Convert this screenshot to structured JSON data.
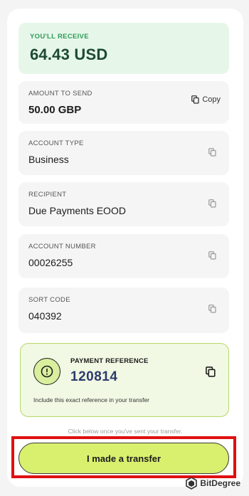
{
  "receive": {
    "label": "YOU'LL RECEIVE",
    "amount": "64.43 USD"
  },
  "amount_to_send": {
    "label": "AMOUNT TO SEND",
    "value": "50.00 GBP",
    "copy_label": "Copy"
  },
  "fields": [
    {
      "label": "ACCOUNT TYPE",
      "value": "Business"
    },
    {
      "label": "RECIPIENT",
      "value": "Due Payments EOOD"
    },
    {
      "label": "ACCOUNT NUMBER",
      "value": "00026255"
    },
    {
      "label": "SORT CODE",
      "value": "040392"
    }
  ],
  "payment_reference": {
    "label": "PAYMENT REFERENCE",
    "value": "120814",
    "hint": "Include this exact reference in your transfer"
  },
  "below_hint": "Click below once you've sent your transfer.",
  "transfer_button": "I made a transfer",
  "watermark": "BitDegree",
  "colors": {
    "accent": "#d9ef6e",
    "receive_bg": "#e6f7ea",
    "highlight": "#e01010"
  }
}
